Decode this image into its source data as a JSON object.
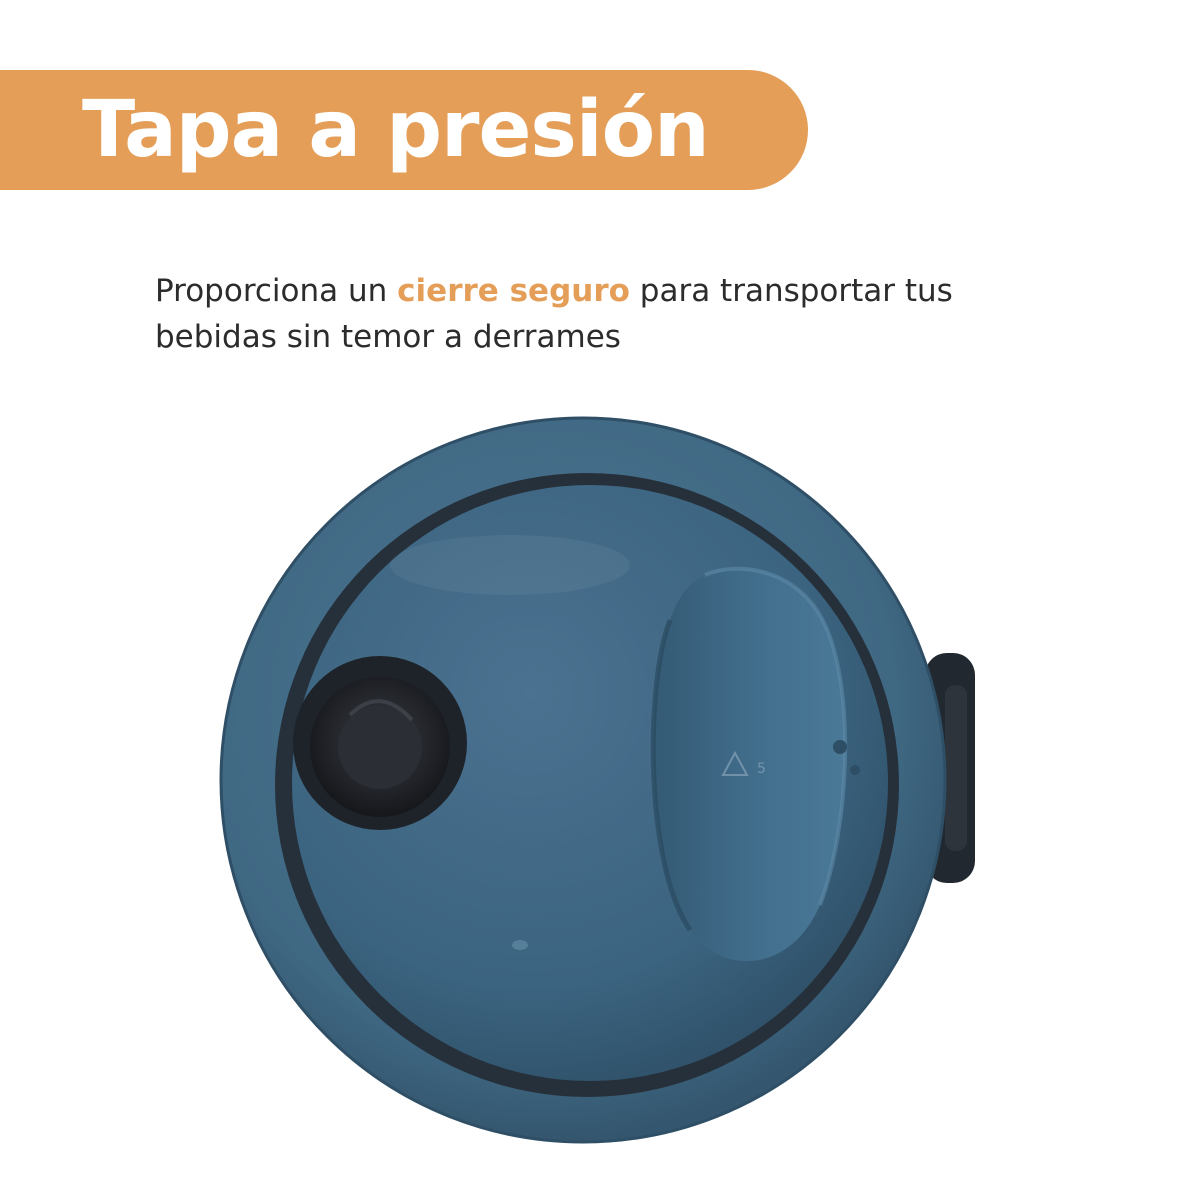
{
  "banner": {
    "title": "Tapa a presión"
  },
  "description": {
    "text_before": "Proporciona un ",
    "highlight": "cierre seguro",
    "text_after": " para transportar tus bebidas sin temor a derrames"
  },
  "colors": {
    "banner": "#E49E58",
    "highlight": "#E49E58",
    "body_text": "#2c2c2c",
    "lid_outer": "#3F6883",
    "lid_inner": "#3A6381",
    "gasket": "#26303A"
  },
  "image": {
    "subject": "blue-press-lid-top-view"
  }
}
